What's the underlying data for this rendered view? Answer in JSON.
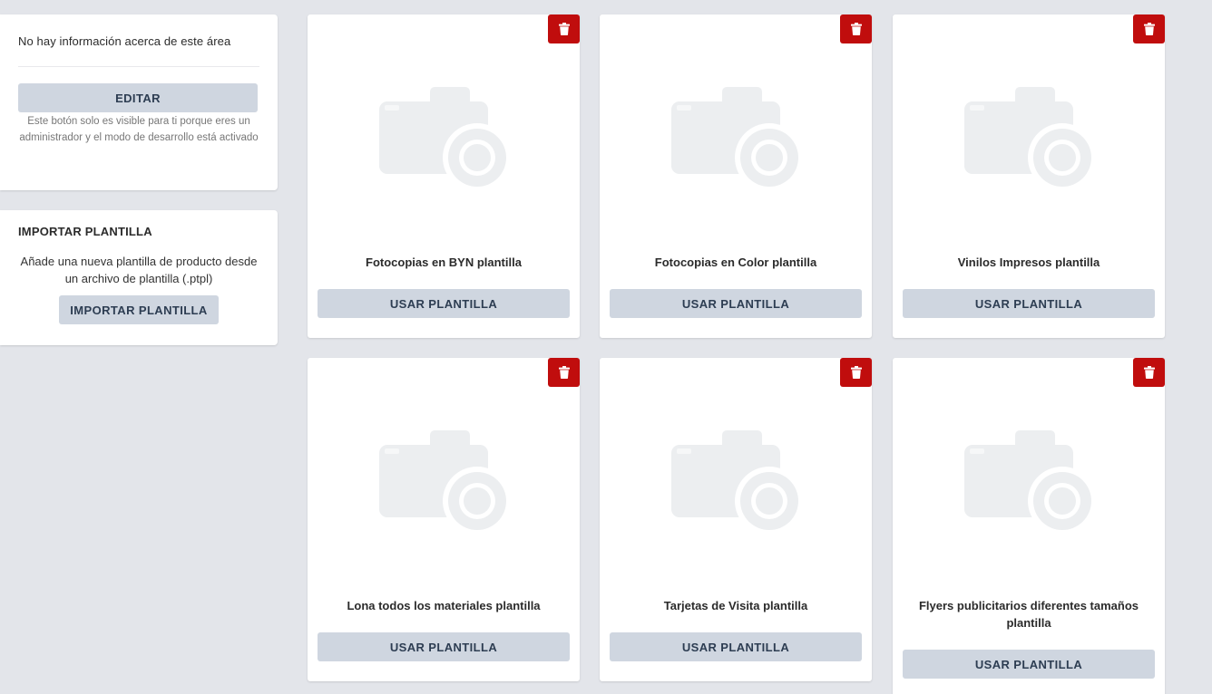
{
  "sidebar": {
    "info_text": "No hay información acerca de este área",
    "edit_label": "EDITAR",
    "admin_note": "Este botón solo es visible para ti porque eres un administrador y el modo de desarrollo está activado",
    "import": {
      "title": "IMPORTAR PLANTILLA",
      "description": "Añade una nueva plantilla de producto desde un archivo de plantilla (.ptpl)",
      "button_label": "IMPORTAR PLANTILLA"
    }
  },
  "templates": [
    {
      "title": "Fotocopias en BYN plantilla",
      "button_label": "USAR PLANTILLA"
    },
    {
      "title": "Fotocopias en Color plantilla",
      "button_label": "USAR PLANTILLA"
    },
    {
      "title": "Vinilos Impresos plantilla",
      "button_label": "USAR PLANTILLA"
    },
    {
      "title": "Lona todos los materiales plantilla",
      "button_label": "USAR PLANTILLA"
    },
    {
      "title": "Tarjetas de Visita plantilla",
      "button_label": "USAR PLANTILLA"
    },
    {
      "title": "Flyers publicitarios diferentes tamaños plantilla",
      "button_label": "USAR PLANTILLA"
    }
  ],
  "icons": {
    "delete": "trash-icon",
    "placeholder": "camera-icon"
  },
  "colors": {
    "background": "#e3e5ea",
    "delete_button": "#c00d0d",
    "secondary_button": "#cfd6e0",
    "placeholder_icon": "#eceef0"
  }
}
